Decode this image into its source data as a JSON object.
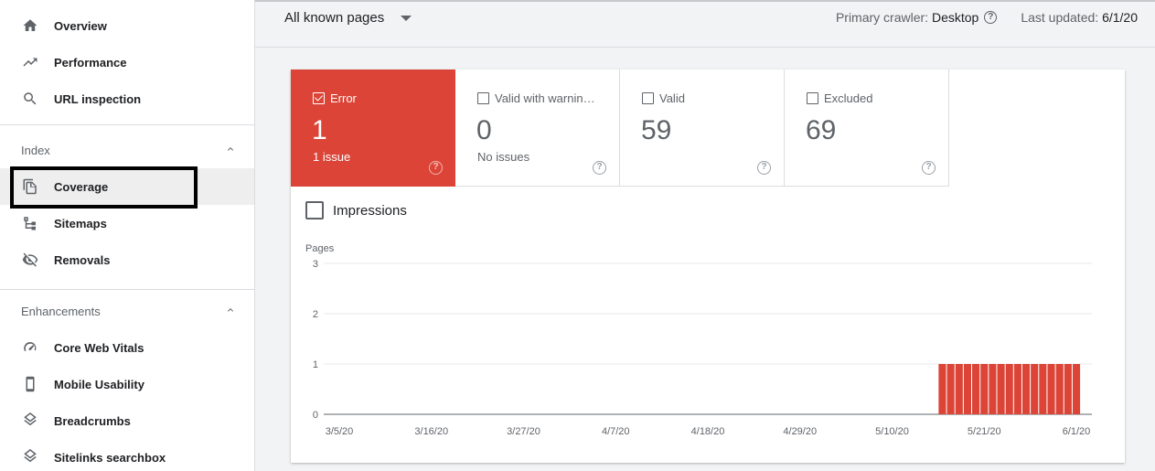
{
  "sidebar": {
    "top_items": [
      {
        "label": "Overview",
        "icon": "home-icon"
      },
      {
        "label": "Performance",
        "icon": "trending-up-icon"
      },
      {
        "label": "URL inspection",
        "icon": "search-icon"
      }
    ],
    "index_section": {
      "title": "Index",
      "items": [
        {
          "label": "Coverage",
          "icon": "coverage-icon",
          "active": true
        },
        {
          "label": "Sitemaps",
          "icon": "sitemap-icon"
        },
        {
          "label": "Removals",
          "icon": "eye-off-icon"
        }
      ]
    },
    "enhancements_section": {
      "title": "Enhancements",
      "items": [
        {
          "label": "Core Web Vitals",
          "icon": "gauge-icon"
        },
        {
          "label": "Mobile Usability",
          "icon": "phone-icon"
        },
        {
          "label": "Breadcrumbs",
          "icon": "layers-icon"
        },
        {
          "label": "Sitelinks searchbox",
          "icon": "layers-icon"
        }
      ]
    }
  },
  "topbar": {
    "filter_label": "All known pages",
    "crawler_label": "Primary crawler:",
    "crawler_value": "Desktop",
    "updated_label": "Last updated:",
    "updated_value": "6/1/20"
  },
  "tiles": [
    {
      "label": "Error",
      "value": "1",
      "sub": "1 issue",
      "checked": true,
      "color": "#db4437"
    },
    {
      "label": "Valid with warnin…",
      "value": "0",
      "sub": "No issues",
      "checked": false
    },
    {
      "label": "Valid",
      "value": "59",
      "sub": "",
      "checked": false
    },
    {
      "label": "Excluded",
      "value": "69",
      "sub": "",
      "checked": false
    }
  ],
  "impressions_label": "Impressions",
  "chart_data": {
    "type": "bar",
    "ylabel": "Pages",
    "ylim": [
      0,
      3
    ],
    "yticks": [
      "0",
      "1",
      "2",
      "3"
    ],
    "xtick_labels": [
      "3/5/20",
      "3/16/20",
      "3/27/20",
      "4/7/20",
      "4/18/20",
      "4/29/20",
      "5/10/20",
      "5/21/20",
      "6/1/20"
    ],
    "x_start": "3/5/20",
    "x_end": "6/1/20",
    "series": [
      {
        "color": "#db4437",
        "bars": [
          {
            "date": "5/16/20",
            "value": 1
          },
          {
            "date": "5/17/20",
            "value": 1
          },
          {
            "date": "5/18/20",
            "value": 1
          },
          {
            "date": "5/19/20",
            "value": 1
          },
          {
            "date": "5/20/20",
            "value": 1
          },
          {
            "date": "5/21/20",
            "value": 1
          },
          {
            "date": "5/22/20",
            "value": 1
          },
          {
            "date": "5/23/20",
            "value": 1
          },
          {
            "date": "5/24/20",
            "value": 1
          },
          {
            "date": "5/25/20",
            "value": 1
          },
          {
            "date": "5/26/20",
            "value": 1
          },
          {
            "date": "5/27/20",
            "value": 1
          },
          {
            "date": "5/28/20",
            "value": 1
          },
          {
            "date": "5/29/20",
            "value": 1
          },
          {
            "date": "5/30/20",
            "value": 1
          },
          {
            "date": "5/31/20",
            "value": 1
          },
          {
            "date": "6/1/20",
            "value": 1
          }
        ]
      }
    ],
    "grid": true
  }
}
